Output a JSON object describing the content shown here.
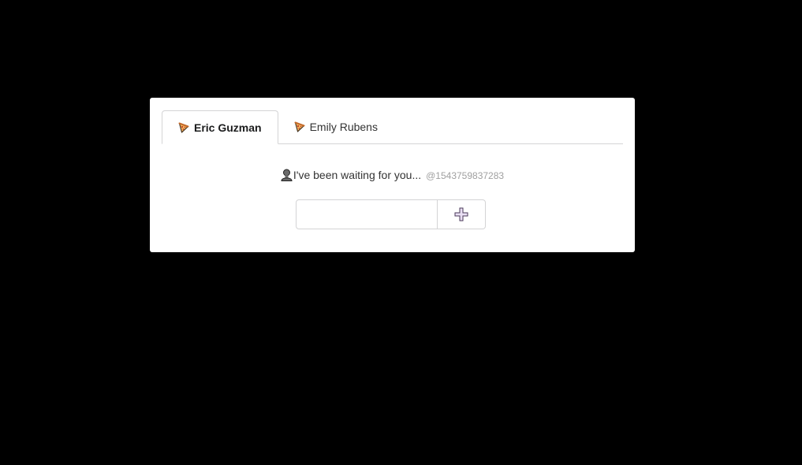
{
  "tabs": [
    {
      "label": "Eric Guzman",
      "icon": "pizza-icon",
      "active": true
    },
    {
      "label": "Emily Rubens",
      "icon": "pizza-icon",
      "active": false
    }
  ],
  "message": {
    "avatar_icon": "person-icon",
    "text": "I've been waiting for you...",
    "timestamp": "@1543759837283"
  },
  "compose": {
    "input_value": "",
    "input_placeholder": "",
    "add_button_icon": "plus-icon"
  },
  "colors": {
    "background": "#000000",
    "card": "#ffffff",
    "border": "#d4d4d5",
    "timestamp": "#a0a0a0"
  }
}
